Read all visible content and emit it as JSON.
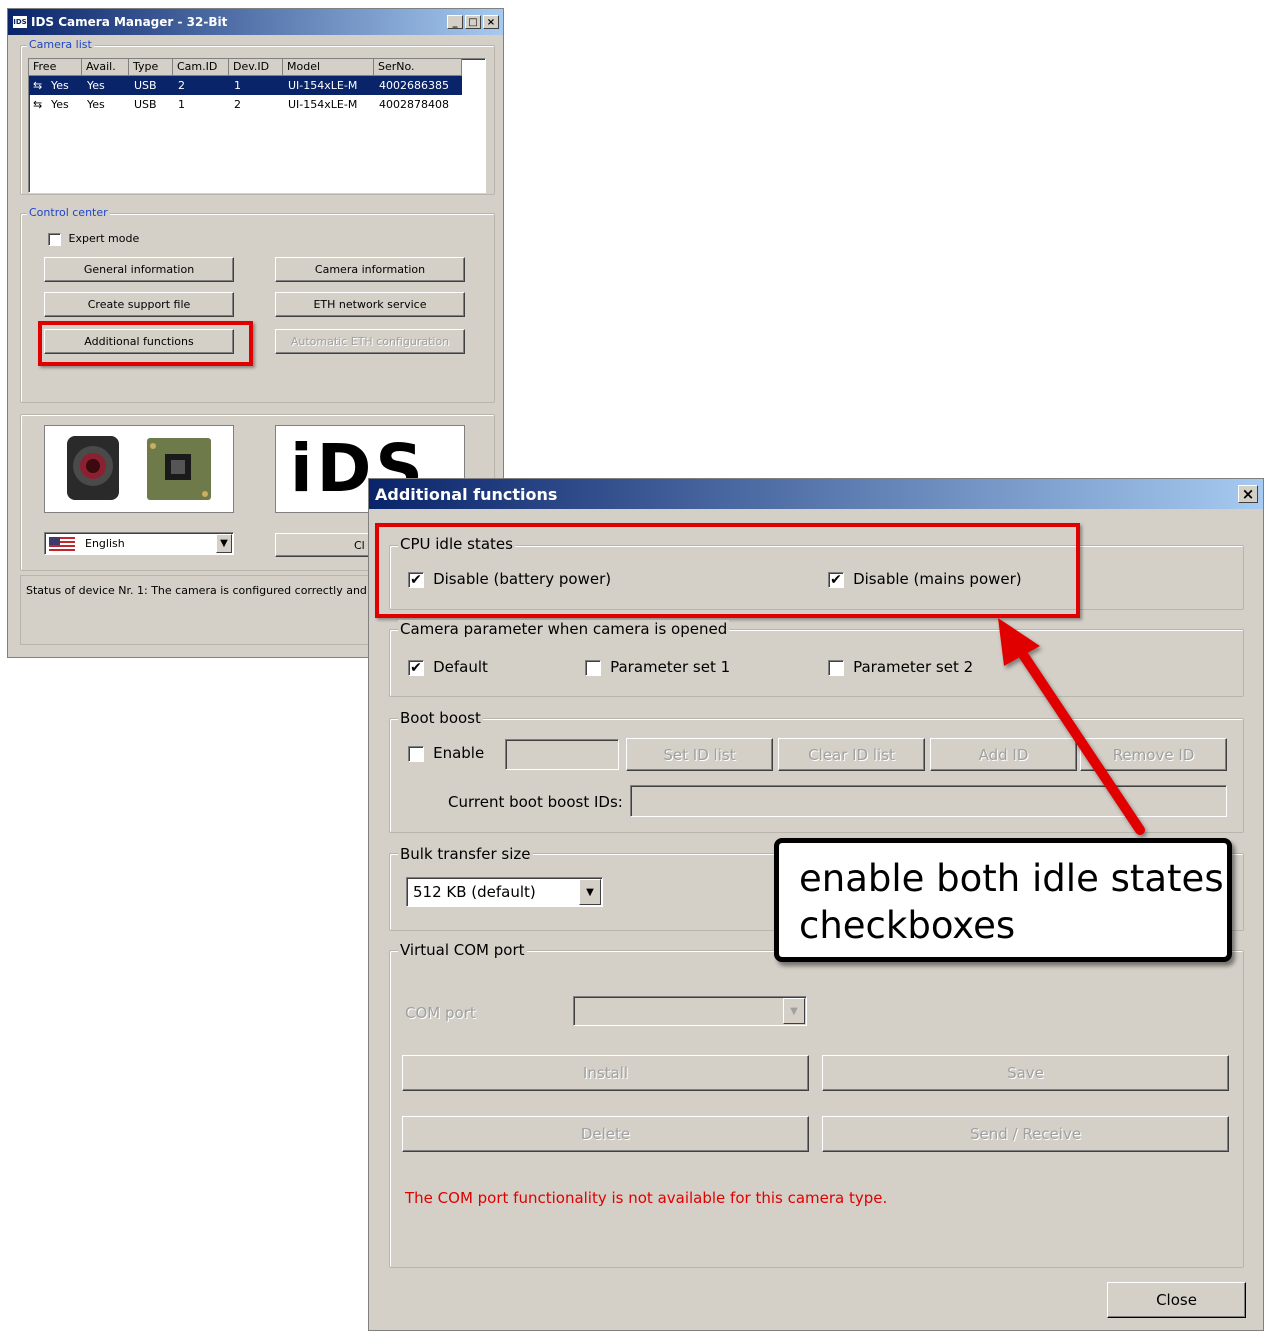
{
  "main_window": {
    "title": "IDS Camera Manager - 32-Bit",
    "app_icon_text": "IDS",
    "window_buttons": [
      "_",
      "□",
      "×"
    ],
    "camera_list": {
      "label": "Camera list",
      "columns": [
        "Free",
        "Avail.",
        "Type",
        "Cam.ID",
        "Dev.ID",
        "Model",
        "SerNo."
      ],
      "rows": [
        {
          "free": "Yes",
          "avail": "Yes",
          "type": "USB",
          "cam_id": "2",
          "dev_id": "1",
          "model": "UI-154xLE-M",
          "serno": "4002686385",
          "selected": true
        },
        {
          "free": "Yes",
          "avail": "Yes",
          "type": "USB",
          "cam_id": "1",
          "dev_id": "2",
          "model": "UI-154xLE-M",
          "serno": "4002878408",
          "selected": false
        }
      ]
    },
    "control_center": {
      "label": "Control center",
      "expert_mode": "Expert mode",
      "expert_mode_checked": false,
      "general_information": "General information",
      "camera_information": "Camera information",
      "create_support_file": "Create support file",
      "eth_network_service": "ETH network service",
      "additional_functions": "Additional functions",
      "automatic_eth_configuration": "Automatic ETH configuration"
    },
    "logo_text": "iDS",
    "language": "English",
    "close_partial": "Cl",
    "status": "Status of device Nr. 1: The camera is configured correctly and c"
  },
  "dialog": {
    "title": "Additional functions",
    "close_x": "×",
    "cpu_idle": {
      "label": "CPU idle states",
      "battery": "Disable (battery power)",
      "battery_checked": true,
      "mains": "Disable (mains power)",
      "mains_checked": true
    },
    "camera_param": {
      "label": "Camera parameter when camera is opened",
      "default": "Default",
      "default_checked": true,
      "set1": "Parameter set 1",
      "set1_checked": false,
      "set2": "Parameter set 2",
      "set2_checked": false
    },
    "boot_boost": {
      "label": "Boot boost",
      "enable": "Enable",
      "enable_checked": false,
      "set_id_list": "Set ID list",
      "clear_id_list": "Clear ID list",
      "add_id": "Add ID",
      "remove_id": "Remove ID",
      "current_ids": "Current boot boost IDs:"
    },
    "bulk": {
      "label": "Bulk transfer size",
      "value": "512 KB (default)"
    },
    "vcom": {
      "label": "Virtual COM port",
      "com_port": "COM port",
      "install": "Install",
      "save": "Save",
      "delete": "Delete",
      "send_receive": "Send / Receive",
      "warning": "The COM port functionality is not available for this camera type."
    },
    "close": "Close"
  },
  "callout": {
    "line1": "enable both idle states",
    "line2": "checkboxes"
  },
  "colors": {
    "title_bar": "#0a246a",
    "highlight": "#e00000",
    "warning_text": "#e00000",
    "group_label_blue": "#1f45c8"
  }
}
